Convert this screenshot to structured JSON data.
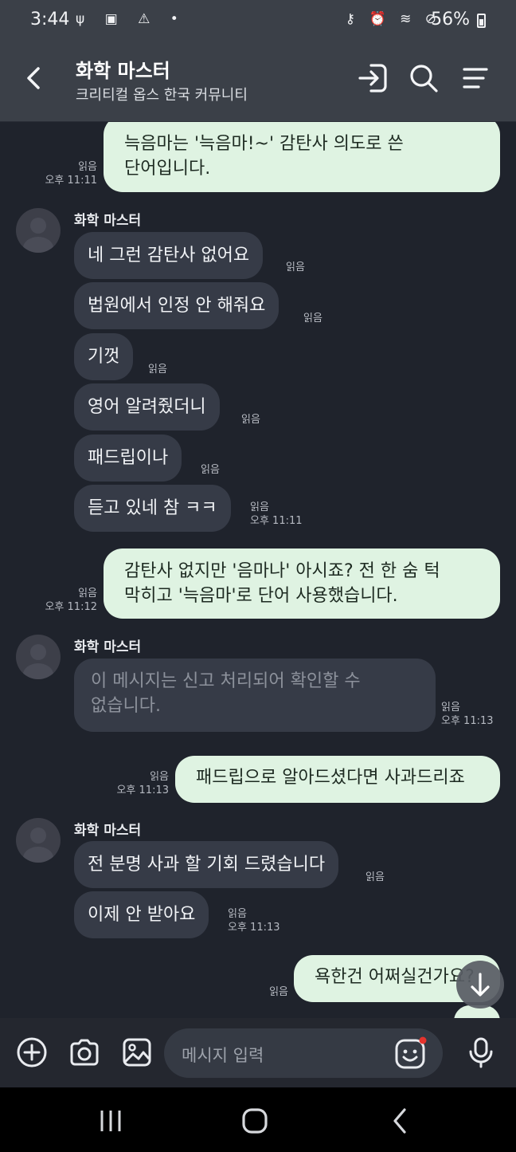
{
  "status_bar": {
    "time": "3:44",
    "left_icons": "ψ ▣ ⚠ •",
    "right_icons": "⚷ ⏰ ≋ ⊘",
    "battery": "56%"
  },
  "header": {
    "title": "화학 마스터",
    "subtitle": "크리티컬 옵스 한국 커뮤니티"
  },
  "messages": [
    {
      "side": "out",
      "lines": [
        "늑음마는 '늑음마!~' 감탄사 의도로 쓴",
        "단어입니다."
      ],
      "read": "읽음",
      "time": "오후 11:11"
    },
    {
      "side": "in",
      "sender": "화학 마스터",
      "text": "네 그런 감탄사 없어요",
      "read": "읽음"
    },
    {
      "side": "in",
      "text": "법원에서 인정 안 해줘요",
      "read": "읽음"
    },
    {
      "side": "in",
      "text": "기껏",
      "read": "읽음"
    },
    {
      "side": "in",
      "text": "영어 알려줬더니",
      "read": "읽음"
    },
    {
      "side": "in",
      "text": "패드립이나",
      "read": "읽음"
    },
    {
      "side": "in",
      "text": "듣고 있네 참 ㅋㅋ",
      "read": "읽음",
      "time": "오후 11:11"
    },
    {
      "side": "out",
      "lines": [
        "감탄사 없지만 '음마나' 아시죠?  전 한 숨 턱",
        "막히고 '늑음마'로 단어 사용했습니다."
      ],
      "read": "읽음",
      "time": "오후 11:12"
    },
    {
      "side": "in",
      "sender": "화학 마스터",
      "lines": [
        "이 메시지는 신고 처리되어 확인할 수",
        "없습니다."
      ],
      "read": "읽음",
      "time": "오후 11:13"
    },
    {
      "side": "out",
      "text": "패드립으로 알아드셨다면 사과드리죠",
      "read": "읽음",
      "time": "오후 11:13"
    },
    {
      "side": "in",
      "sender": "화학 마스터",
      "text": "전 분명 사과 할 기회 드렸습니다",
      "read": "읽음"
    },
    {
      "side": "in",
      "text": "이제 안 받아요",
      "read": "읽음",
      "time": "오후 11:13"
    },
    {
      "side": "out",
      "text": "욕한건 어쩌실건가요?",
      "read": "읽음"
    }
  ],
  "input": {
    "placeholder": "메시지 입력"
  },
  "colors": {
    "background": "#1f232c",
    "header": "#3b4048",
    "outgoing_bubble": "#dff3e2",
    "incoming_bubble": "#363b47",
    "notification_dot": "#e5332d"
  },
  "icons": {
    "header": [
      "back-icon",
      "exit-chat-icon",
      "search-icon",
      "menu-icon"
    ],
    "input_bar": [
      "add-icon",
      "camera-icon",
      "gallery-icon",
      "emoji-icon",
      "mic-icon"
    ],
    "nav": [
      "recent-apps-icon",
      "home-icon",
      "back-nav-icon"
    ],
    "scroll": "arrow-down-icon"
  }
}
